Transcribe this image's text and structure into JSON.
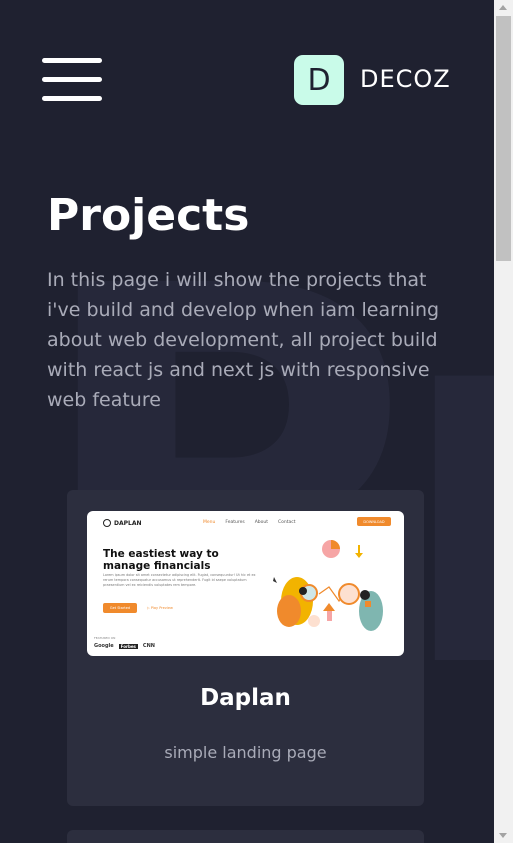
{
  "header": {
    "menu_icon": "hamburger-menu-icon",
    "logo_letter": "D",
    "logo_text": "DECOZ",
    "logo_color": "#c9fbe9"
  },
  "page": {
    "title": "Projects",
    "intro": "In this page i will show the projects that i've build and develop when iam learning about web development, all project build with react js and next js with responsive web feature",
    "background_color": "#1f2130"
  },
  "projects": [
    {
      "name": "Daplan",
      "description": "simple landing page",
      "preview": {
        "brand": "DAPLAN",
        "nav": [
          "Menu",
          "Features",
          "About",
          "Contact"
        ],
        "download_label": "DOWNLOAD",
        "headline": "The eastiest way to manage financials",
        "body": "Lorem ipsum dolor sit amet consectetur adipiscing elit. Fugiat, consequuntur! Ut hic et ex rerum tempora consequatur accusamus ut reprehenderit. Fugit id saepe voluptatum praesentium vel ex reiciendis voluptates rem tempore.",
        "cta_primary": "Get Started",
        "cta_secondary": "Play Preview",
        "featured_label": "FEATURED ON",
        "brands": [
          "Google",
          "Forbes",
          "CNN"
        ],
        "accent_color": "#f08a2c"
      }
    }
  ],
  "scrollbar": {
    "up_icon": "scroll-up-arrow-icon",
    "down_icon": "scroll-down-arrow-icon"
  }
}
